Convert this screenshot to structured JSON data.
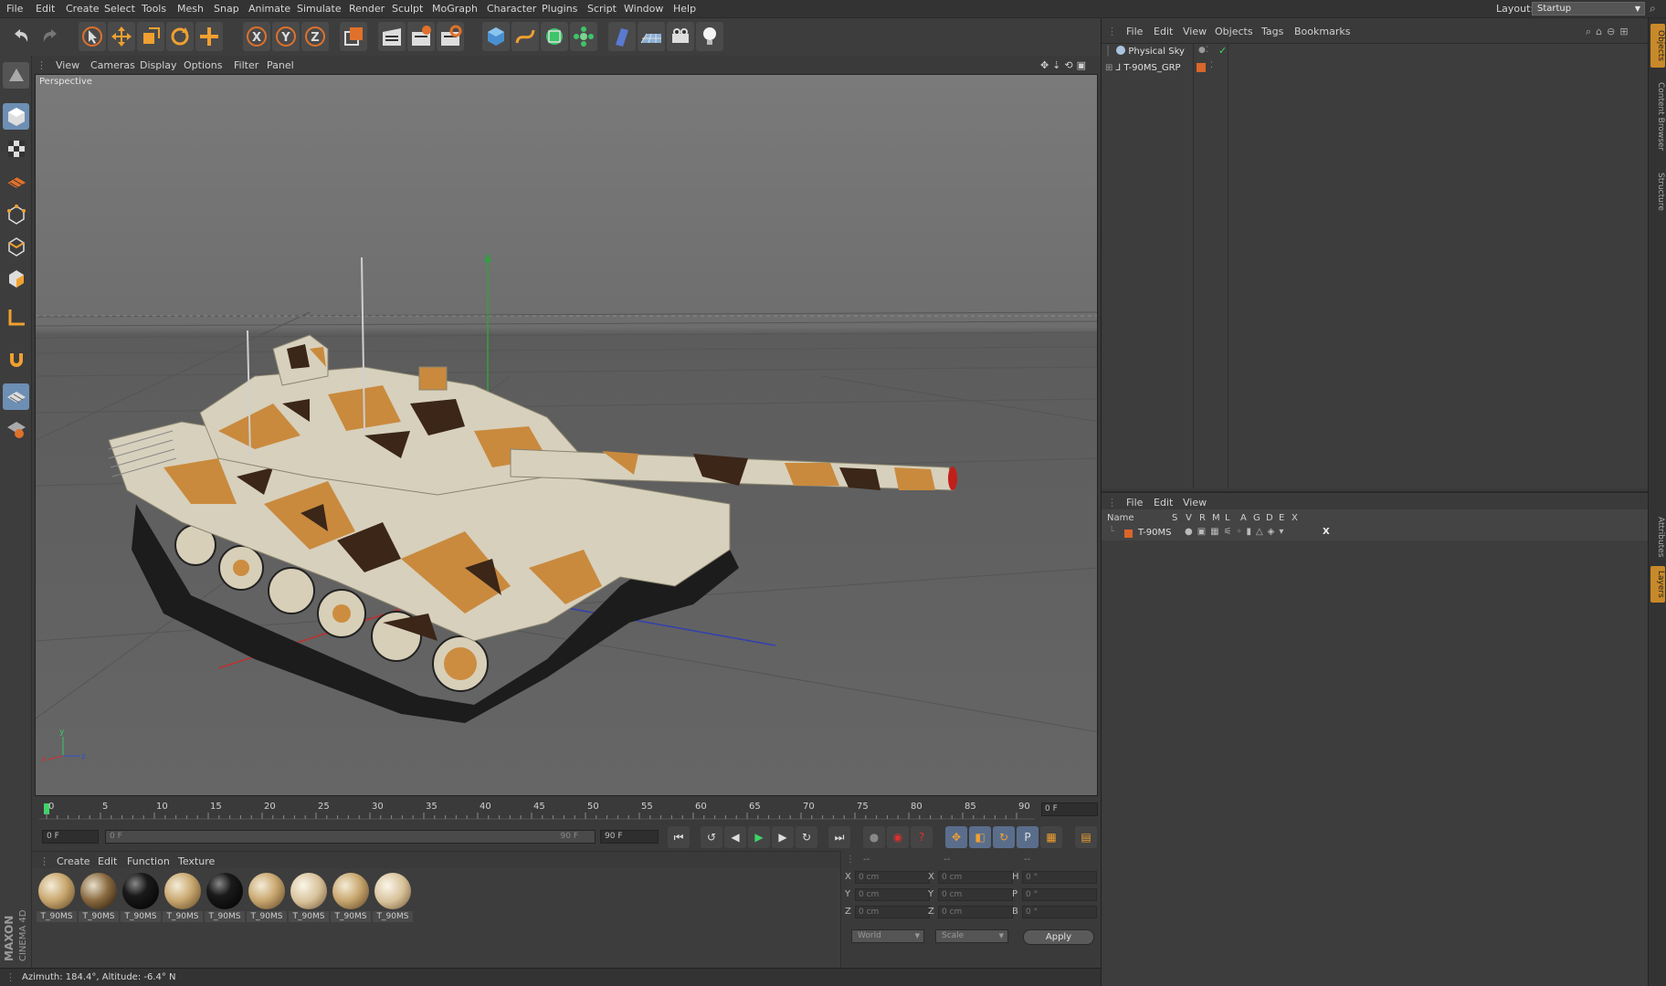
{
  "menubar": {
    "items": [
      "File",
      "Edit",
      "Create",
      "Select",
      "Tools",
      "Mesh",
      "Snap",
      "Animate",
      "Simulate",
      "Render",
      "Sculpt",
      "MoGraph",
      "Character",
      "Plugins",
      "Script",
      "Window",
      "Help"
    ],
    "layout_label": "Layout:",
    "layout_value": "Startup"
  },
  "toolbar": {
    "icons": [
      "undo-icon",
      "redo-icon",
      "live-selection-icon",
      "move-icon",
      "scale-icon",
      "rotate-icon",
      "add-icon",
      "x-axis-icon",
      "y-axis-icon",
      "z-axis-icon",
      "coordinate-system-icon",
      "render-view-icon",
      "render-picture-viewer-icon",
      "edit-render-settings-icon",
      "cube-icon",
      "spline-pen-icon",
      "subdivision-icon",
      "array-icon",
      "deformer-icon",
      "floor-icon",
      "camera-icon",
      "light-icon"
    ],
    "axis_labels": [
      "X",
      "Y",
      "Z"
    ]
  },
  "leftbar": {
    "icons": [
      "make-editable-icon",
      "model-mode-icon",
      "texture-mode-icon",
      "workplane-icon",
      "points-mode-icon",
      "edges-mode-icon",
      "polygons-mode-icon",
      "axis-mode-icon",
      "snap-icon",
      "lock-workplane-icon",
      "planar-workplane-icon"
    ],
    "logo_line1": "MAXON",
    "logo_line2": "CINEMA 4D"
  },
  "viewport": {
    "menu": [
      "View",
      "Cameras",
      "Display",
      "Options",
      "Filter",
      "Panel"
    ],
    "label": "Perspective",
    "axis_gizmo": {
      "x": "x",
      "y": "y",
      "z": "z"
    }
  },
  "timeline": {
    "ticks": [
      "0",
      "5",
      "10",
      "15",
      "20",
      "25",
      "30",
      "35",
      "40",
      "45",
      "50",
      "55",
      "60",
      "65",
      "70",
      "75",
      "80",
      "85",
      "90"
    ],
    "frame_counter": "0 F"
  },
  "playback": {
    "current_frame": "0 F",
    "range_start": "0 F",
    "range_end": "90 F",
    "max_frame": "90 F",
    "button_icons": [
      "goto-start-icon",
      "prev-key-icon",
      "prev-frame-icon",
      "play-icon",
      "next-frame-icon",
      "next-key-icon",
      "goto-end-icon",
      "record-off-icon",
      "autokey-icon",
      "keyframe-selection-icon",
      "position-key-icon",
      "scale-key-icon",
      "rotation-key-icon",
      "param-key-icon",
      "pla-key-icon",
      "timeline-icon"
    ],
    "param_letter": "P"
  },
  "materials": {
    "menu": [
      "Create",
      "Edit",
      "Function",
      "Texture"
    ],
    "items": [
      {
        "label": "T_90MS",
        "style": "camo"
      },
      {
        "label": "T_90MS",
        "style": "camo-dark"
      },
      {
        "label": "T_90MS",
        "style": "black"
      },
      {
        "label": "T_90MS",
        "style": "camo"
      },
      {
        "label": "T_90MS",
        "style": "black"
      },
      {
        "label": "T_90MS",
        "style": "camo"
      },
      {
        "label": "T_90MS",
        "style": "camo-light"
      },
      {
        "label": "T_90MS",
        "style": "camo"
      },
      {
        "label": "T_90MS",
        "style": "camo-light"
      }
    ]
  },
  "coordinates": {
    "header_left": "--",
    "header_mid": "--",
    "header_right": "--",
    "rows": [
      {
        "a": "X",
        "av": "0 cm",
        "b": "X",
        "bv": "0 cm",
        "c": "H",
        "cv": "0 °"
      },
      {
        "a": "Y",
        "av": "0 cm",
        "b": "Y",
        "bv": "0 cm",
        "c": "P",
        "cv": "0 °"
      },
      {
        "a": "Z",
        "av": "0 cm",
        "b": "Z",
        "bv": "0 cm",
        "c": "B",
        "cv": "0 °"
      }
    ],
    "space": "World",
    "mode": "Scale",
    "apply": "Apply"
  },
  "status": {
    "text": "Azimuth: 184.4°, Altitude: -6.4°  N"
  },
  "object_manager": {
    "menu": [
      "File",
      "Edit",
      "View",
      "Objects",
      "Tags",
      "Bookmarks"
    ],
    "objects": [
      {
        "name": "Physical Sky",
        "icon": "physical-sky-icon"
      },
      {
        "name": "T-90MS_GRP",
        "icon": "null-group-icon"
      }
    ]
  },
  "layer_manager": {
    "menu": [
      "File",
      "Edit",
      "View"
    ],
    "columns": [
      "Name",
      "S",
      "V",
      "R",
      "M",
      "L",
      "A",
      "G",
      "D",
      "E",
      "X"
    ],
    "layers": [
      {
        "name": "T-90MS",
        "color": "#d9662a"
      }
    ]
  },
  "side_tabs": [
    "Objects",
    "Content Browser",
    "Structure",
    "Attributes",
    "Layers"
  ],
  "colors": {
    "accent": "#f0a030",
    "layer": "#d9662a",
    "play": "#3ed36a",
    "record": "#e03030"
  }
}
